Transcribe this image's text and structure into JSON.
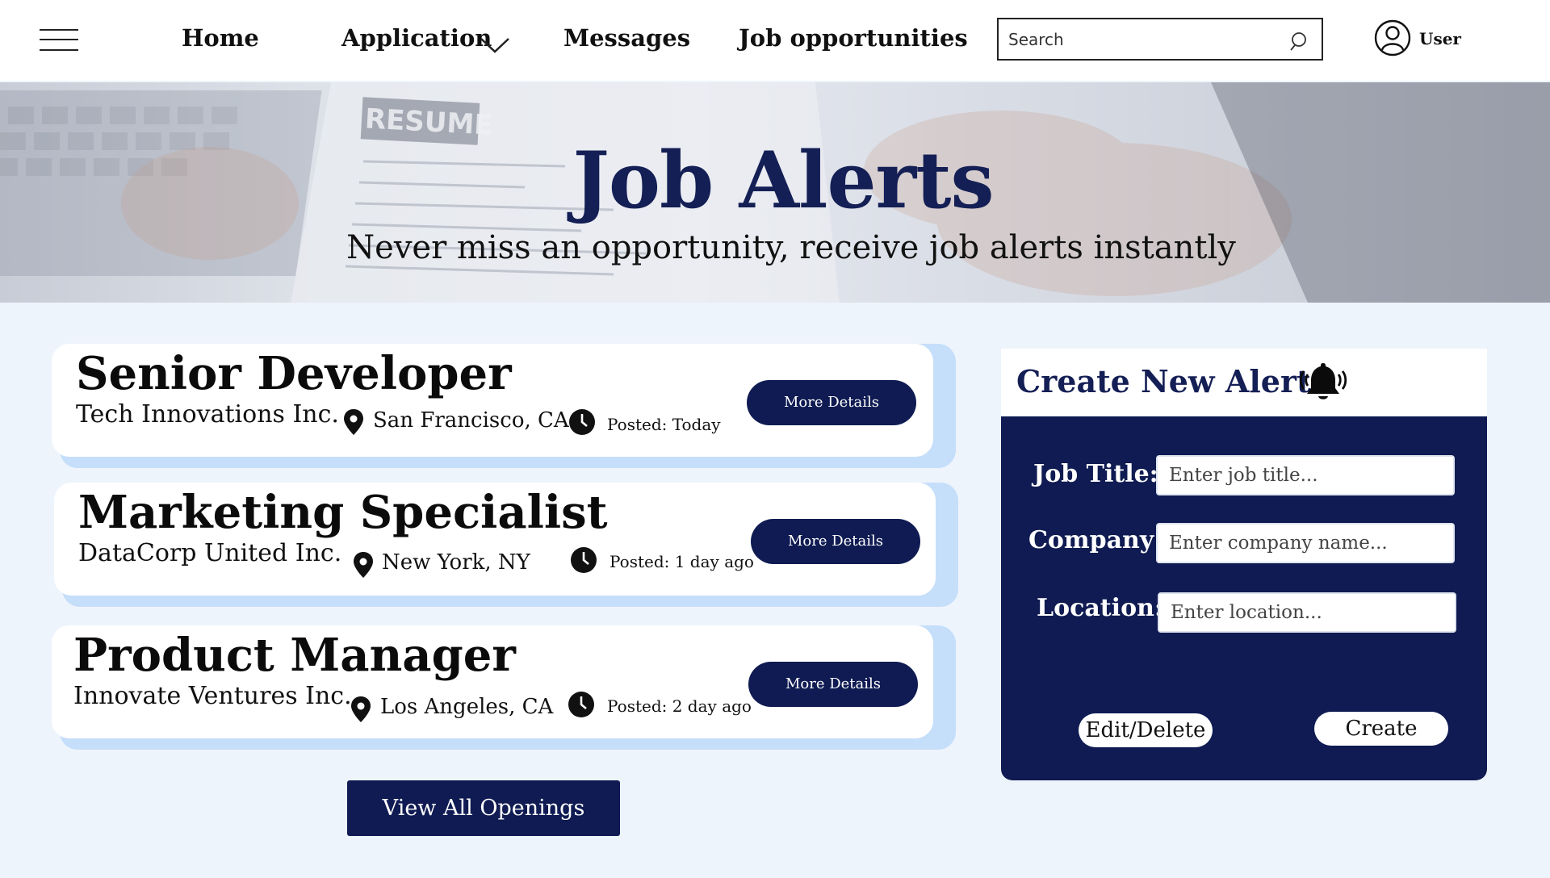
{
  "nav": {
    "links": [
      "Home",
      "Application",
      "Messages",
      "Job opportunities"
    ],
    "search_placeholder": "Search",
    "user_label": "User"
  },
  "hero": {
    "title": "Job Alerts",
    "subtitle": "Never miss an opportunity, receive job alerts instantly",
    "image_text": "RESUME"
  },
  "jobs": [
    {
      "title": "Senior Developer",
      "company": "Tech Innovations Inc.",
      "location": "San Francisco, CA",
      "posted": "Posted: Today",
      "button": "More Details"
    },
    {
      "title": "Marketing Specialist",
      "company": "DataCorp United Inc.",
      "location": "New York, NY",
      "posted": "Posted: 1 day ago",
      "button": "More Details"
    },
    {
      "title": "Product Manager",
      "company": "Innovate Ventures Inc.",
      "location": "Los Angeles, CA",
      "posted": "Posted: 2 day ago",
      "button": "More Details"
    }
  ],
  "view_all_label": "View All Openings",
  "alert": {
    "title": "Create New Alert",
    "fields": [
      {
        "label": "Job Title:",
        "placeholder": "Enter job title..."
      },
      {
        "label": "Company:",
        "placeholder": "Enter company name..."
      },
      {
        "label": "Location:",
        "placeholder": "Enter location..."
      }
    ],
    "edit_label": "Edit/Delete",
    "create_label": "Create"
  },
  "colors": {
    "navy": "#0f1b52",
    "light_blue": "#c5defa",
    "page_bg": "#eef4fc"
  },
  "icons": [
    "menu-icon",
    "chevron-down-icon",
    "search-icon",
    "user-icon",
    "location-pin-icon",
    "clock-icon",
    "bell-icon"
  ]
}
